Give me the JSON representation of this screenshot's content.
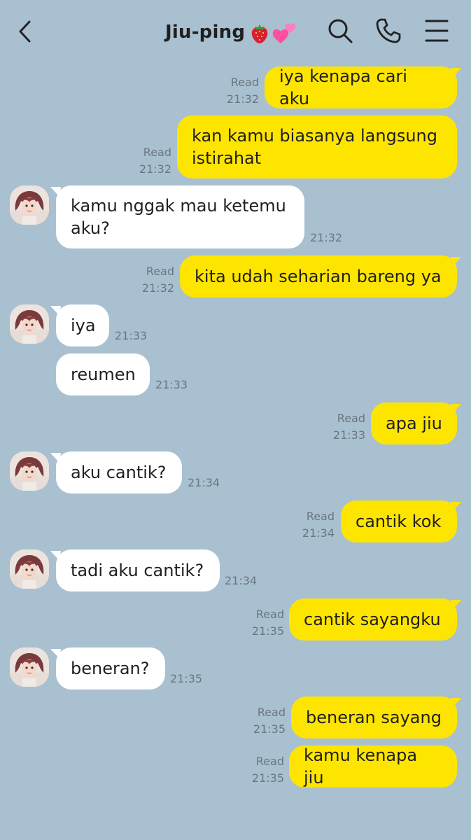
{
  "header": {
    "title": "Jiu-ping",
    "title_emojis": [
      "strawberry-icon",
      "two-hearts-icon"
    ],
    "icons": [
      "back-chevron-icon",
      "search-icon",
      "phone-icon",
      "menu-icon"
    ]
  },
  "colors": {
    "background": "#a9c0d1",
    "my_bubble": "#fee500",
    "their_bubble": "#ffffff",
    "meta_text": "#6b7680"
  },
  "messages": [
    {
      "sender": "me",
      "text": "iya kenapa cari aku",
      "status": "Read",
      "time": "21:32"
    },
    {
      "sender": "me",
      "text": "kan kamu biasanya langsung istirahat",
      "status": "Read",
      "time": "21:32"
    },
    {
      "sender": "them",
      "text": "kamu nggak mau ketemu aku?",
      "time": "21:32"
    },
    {
      "sender": "me",
      "text": "kita udah seharian bareng ya",
      "status": "Read",
      "time": "21:32"
    },
    {
      "sender": "them",
      "text": "iya",
      "time": "21:33"
    },
    {
      "sender": "them",
      "text": "reumen",
      "time": "21:33"
    },
    {
      "sender": "me",
      "text": "apa jiu",
      "status": "Read",
      "time": "21:33"
    },
    {
      "sender": "them",
      "text": "aku cantik?",
      "time": "21:34"
    },
    {
      "sender": "me",
      "text": "cantik kok",
      "status": "Read",
      "time": "21:34"
    },
    {
      "sender": "them",
      "text": "tadi aku cantik?",
      "time": "21:34"
    },
    {
      "sender": "me",
      "text": "cantik sayangku",
      "status": "Read",
      "time": "21:35"
    },
    {
      "sender": "them",
      "text": "beneran?",
      "time": "21:35"
    },
    {
      "sender": "me",
      "text": "beneran sayang",
      "status": "Read",
      "time": "21:35"
    },
    {
      "sender": "me",
      "text": "kamu kenapa jiu",
      "status": "Read",
      "time": "21:35"
    }
  ]
}
